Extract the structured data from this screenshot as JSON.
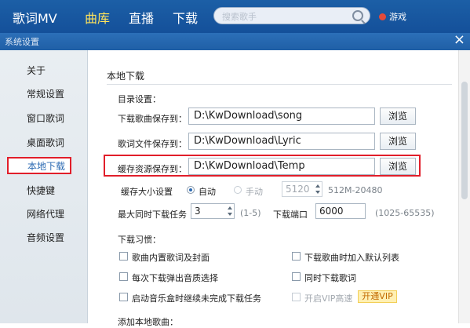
{
  "topbar": {
    "nav": [
      "歌词MV",
      "曲库",
      "直播",
      "下载"
    ],
    "search_placeholder": "搜索歌手",
    "game_label": "游戏"
  },
  "window": {
    "title": "系统设置",
    "close": "×"
  },
  "sidebar": {
    "items": [
      "关于",
      "常规设置",
      "窗口歌词",
      "桌面歌词",
      "本地下载",
      "快捷键",
      "网络代理",
      "音频设置"
    ],
    "active_index": 4
  },
  "main": {
    "section_title": "本地下载",
    "dir_label": "目录设置：",
    "rows": [
      {
        "label": "下载歌曲保存到：",
        "path": "D:\\KwDownload\\song",
        "button": "浏览"
      },
      {
        "label": "歌词文件保存到：",
        "path": "D:\\KwDownload\\Lyric",
        "button": "浏览"
      },
      {
        "label": "缓存资源保存到：",
        "path": "D:\\KwDownload\\Temp",
        "button": "浏览"
      }
    ],
    "cache": {
      "label": "缓存大小设置",
      "auto": "自动",
      "manual": "手动",
      "size_value": "5120",
      "size_range": "512M-20480"
    },
    "max_tasks": {
      "label": "最大同时下载任务",
      "value": "3",
      "range": "(1-5)"
    },
    "port": {
      "label": "下载端口",
      "value": "6000",
      "range": "(1025-65535)"
    },
    "habit_title": "下载习惯：",
    "checkboxes": [
      {
        "label": "歌曲内置歌词及封面",
        "disabled": false
      },
      {
        "label": "下载歌曲时加入默认列表",
        "disabled": false
      },
      {
        "label": "每次下载弹出音质选择",
        "disabled": false
      },
      {
        "label": "同时下载歌词",
        "disabled": false
      },
      {
        "label": "启动音乐盒时继续未完成下载任务",
        "disabled": false
      },
      {
        "label": "开启VIP高速",
        "disabled": true
      }
    ],
    "vip_button": "开通VIP",
    "add_local": "添加本地歌曲："
  },
  "colors": {
    "topbar": "#1c5fa6",
    "active_nav": "#ffe35c",
    "highlight": "#e11e2a",
    "link": "#2d6bb3"
  }
}
